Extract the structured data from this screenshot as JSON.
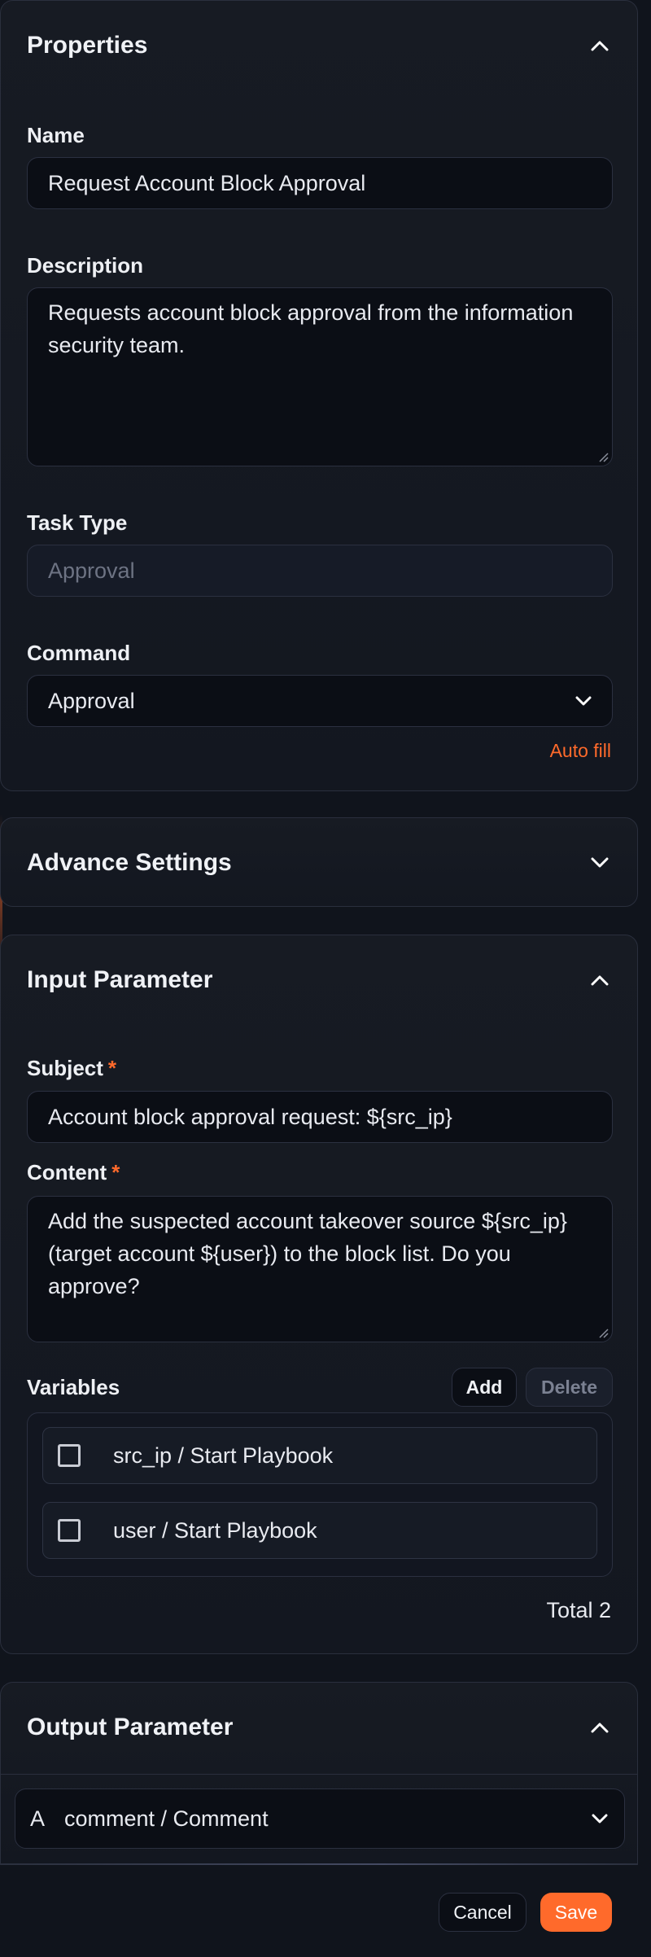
{
  "properties": {
    "title": "Properties",
    "name_label": "Name",
    "name_value": "Request Account Block Approval",
    "description_label": "Description",
    "description_value": "Requests account block approval from the information security team.",
    "task_type_label": "Task Type",
    "task_type_value": "Approval",
    "command_label": "Command",
    "command_value": "Approval",
    "auto_fill": "Auto fill"
  },
  "advance_settings": {
    "title": "Advance Settings"
  },
  "input_parameter": {
    "title": "Input Parameter",
    "subject_label": "Subject",
    "subject_value": "Account block approval request: ${src_ip}",
    "content_label": "Content",
    "content_value": "Add the suspected account takeover source ${src_ip} (target account ${user}) to the block list. Do you approve?",
    "required_mark": "*",
    "variables_label": "Variables",
    "add_label": "Add",
    "delete_label": "Delete",
    "variables": [
      {
        "label": "src_ip / Start Playbook"
      },
      {
        "label": "user / Start Playbook"
      }
    ],
    "total": "Total 2"
  },
  "output_parameter": {
    "title": "Output Parameter",
    "items": [
      {
        "type": "A",
        "label": "comment / Comment"
      }
    ]
  },
  "footer": {
    "cancel_label": "Cancel",
    "save_label": "Save"
  },
  "colors": {
    "accent": "#ff6a2b",
    "background": "#10141c",
    "panel": "#171b23"
  }
}
